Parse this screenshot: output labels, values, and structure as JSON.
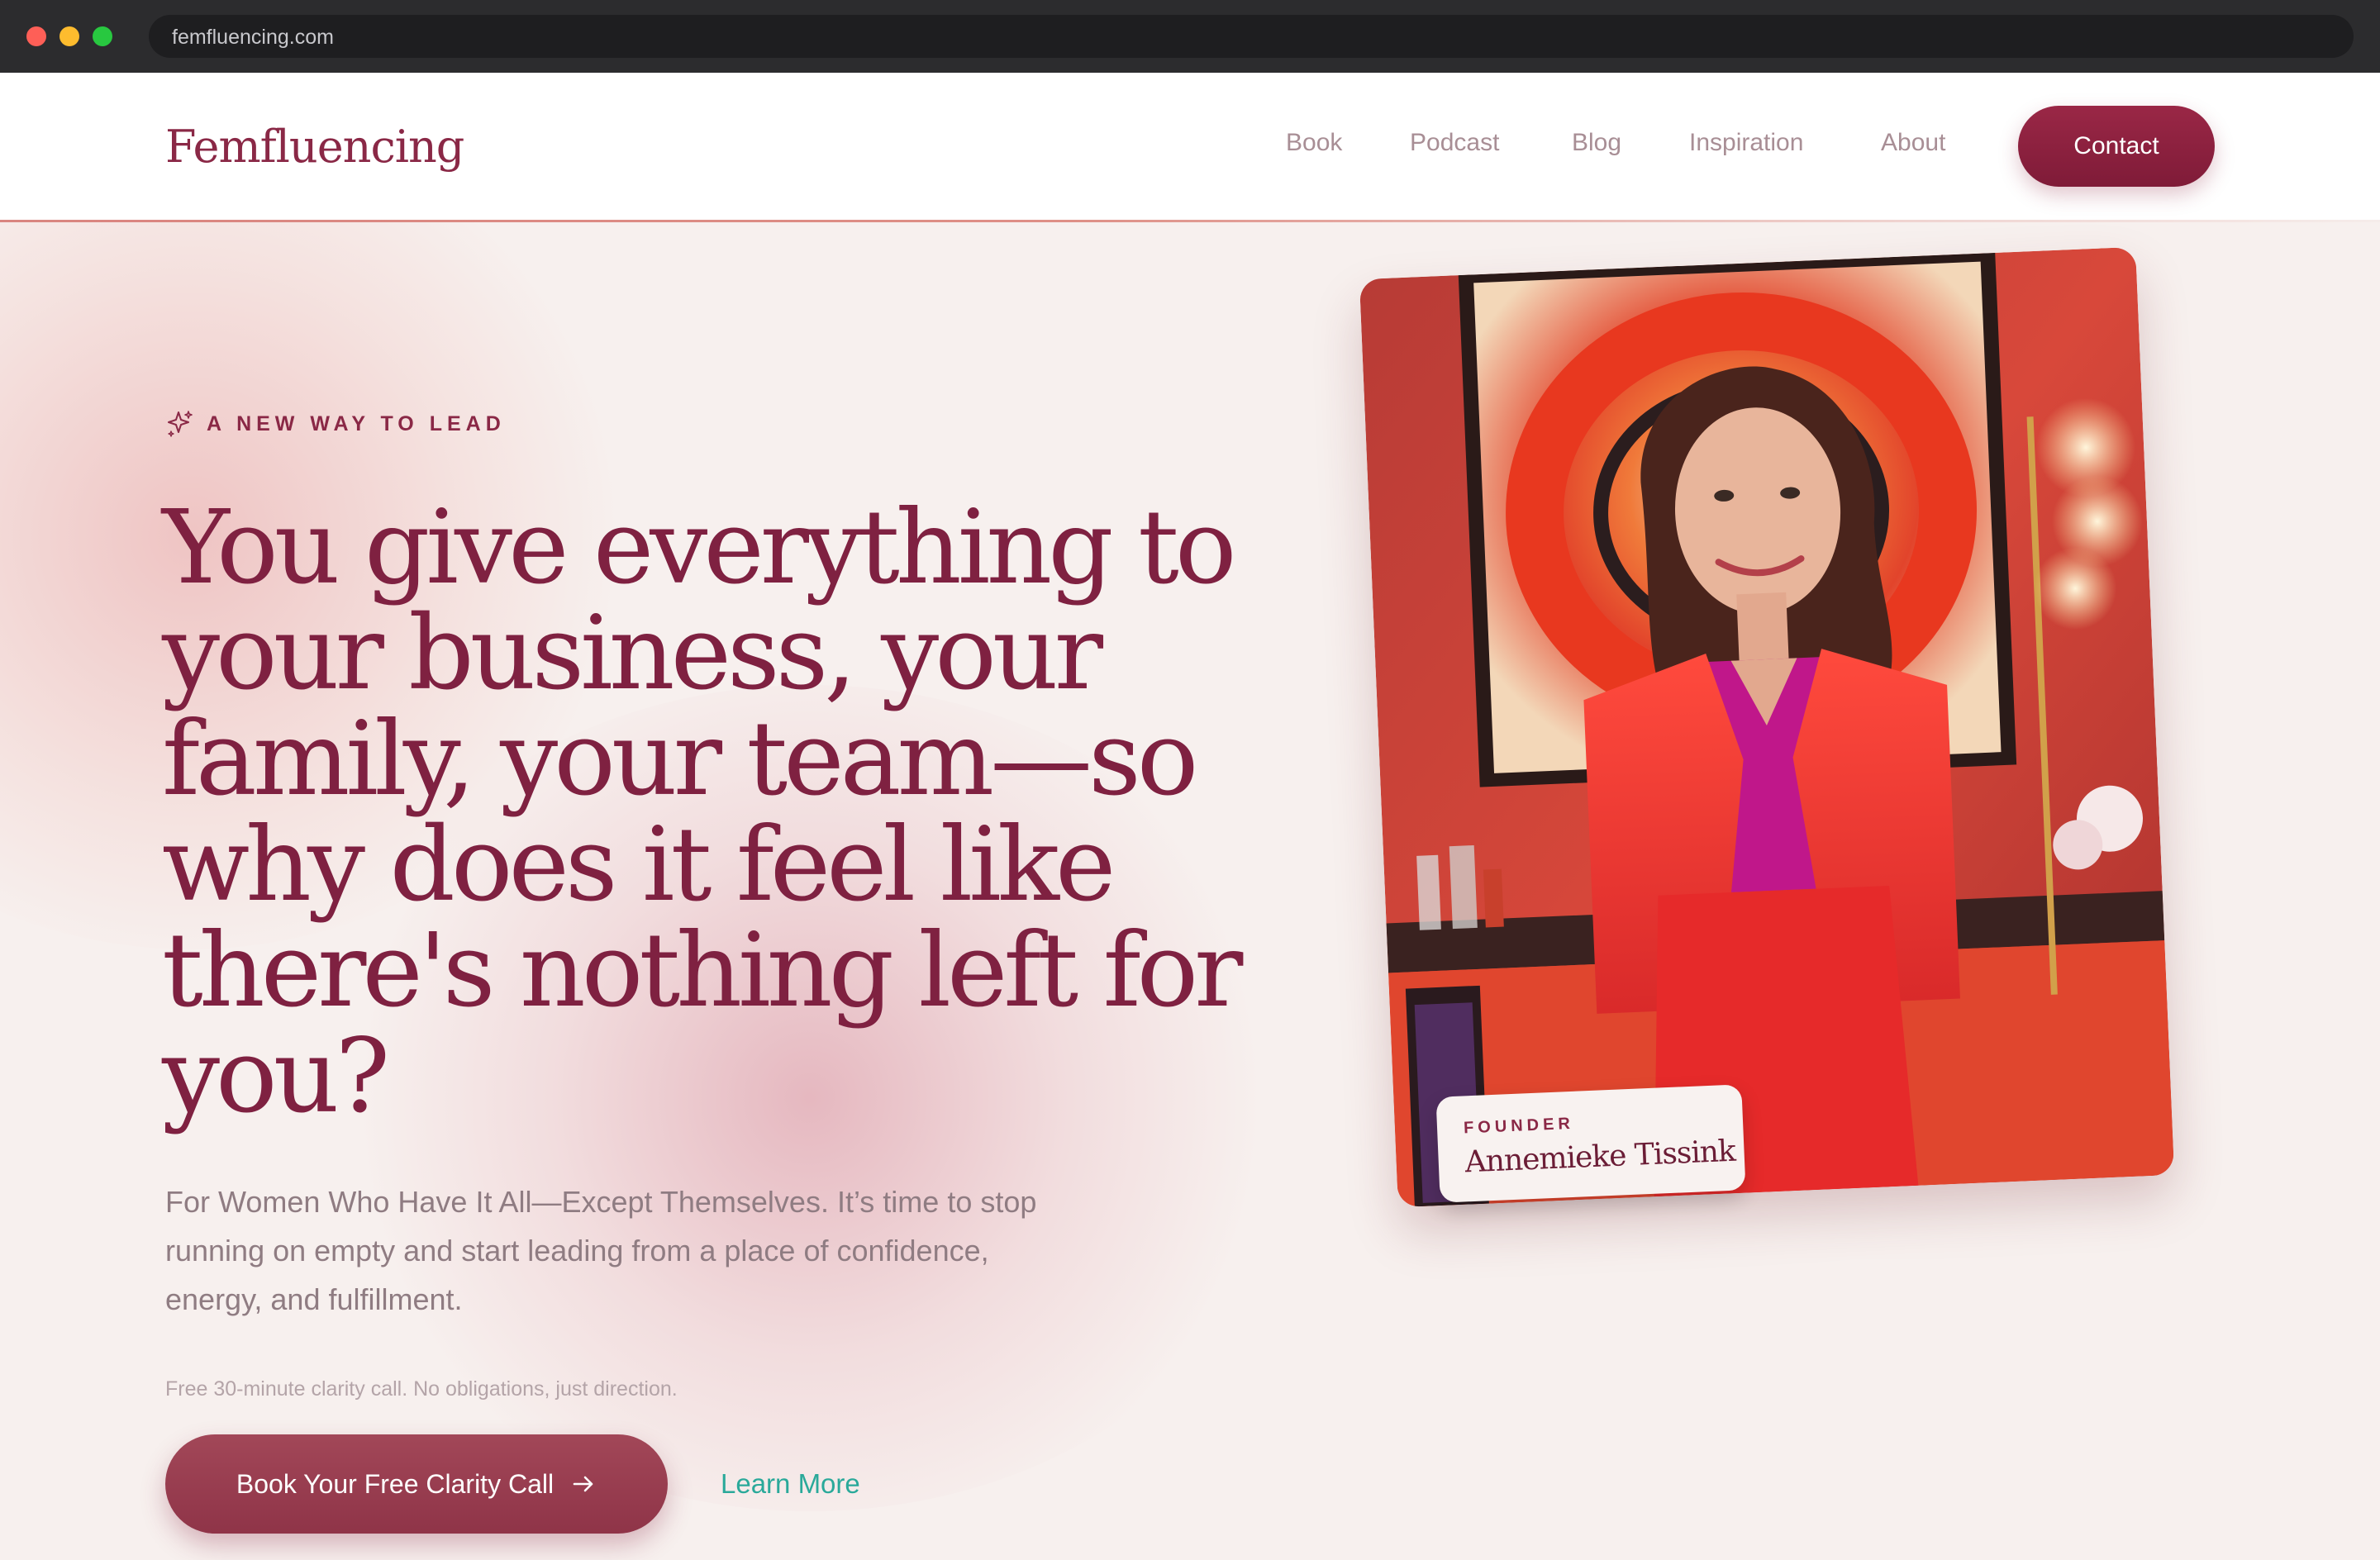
{
  "browser": {
    "url": "femfluencing.com"
  },
  "header": {
    "logo": "Femfluencing",
    "nav": [
      "Book",
      "Podcast",
      "Blog",
      "Inspiration",
      "About"
    ],
    "contact_label": "Contact"
  },
  "hero": {
    "eyebrow": "A NEW WAY TO LEAD",
    "headline": "You give everything to your business, your family, your team—so why does it feel like there's nothing left for you?",
    "subtext": "For Women Who Have It All—Except Themselves. It’s time to stop running on empty and start leading from a place of confidence, energy, and fulfillment.",
    "note": "Free 30-minute clarity call. No obligations, just direction.",
    "cta_label": "Book Your Free Clarity Call",
    "learn_more": "Learn More"
  },
  "founder": {
    "label": "FOUNDER",
    "name": "Annemieke Tissink"
  },
  "colors": {
    "brand": "#8a2846",
    "cta": "#9b3e51",
    "link": "#2aa99a",
    "background": "#f7f0ee"
  }
}
